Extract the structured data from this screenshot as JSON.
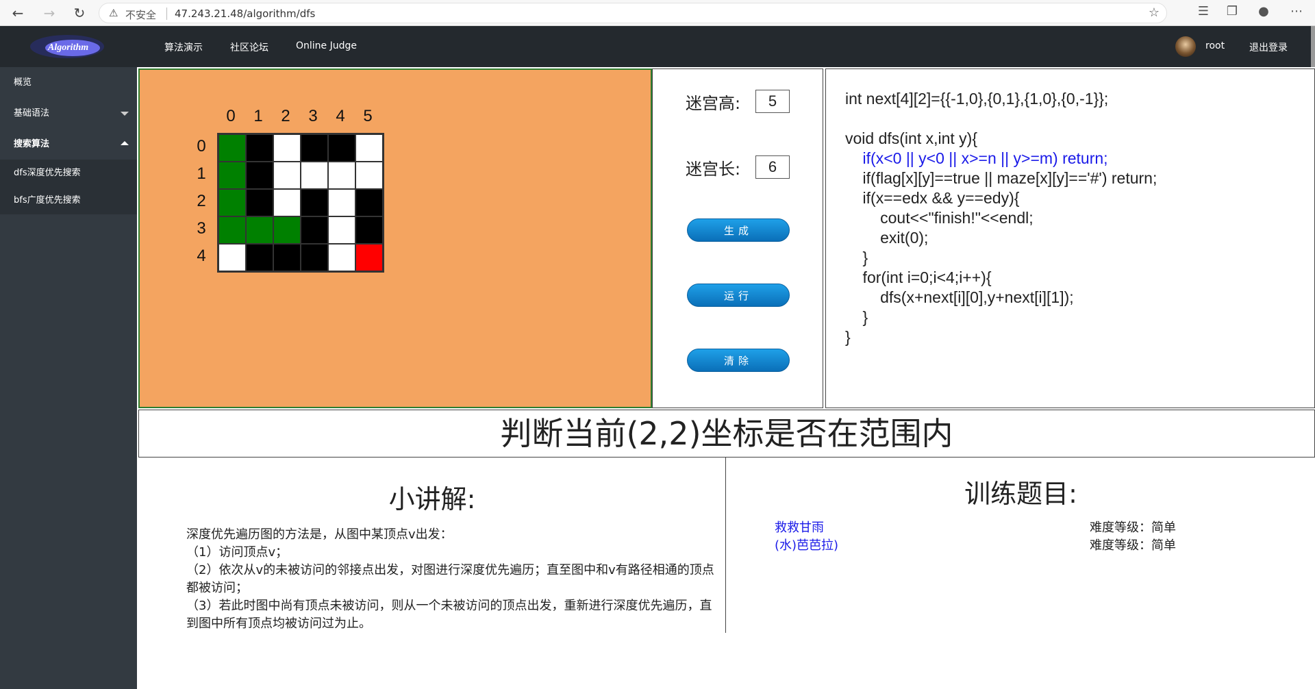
{
  "browser": {
    "insecure_label": "不安全",
    "url": "47.243.21.48/algorithm/dfs"
  },
  "topnav": {
    "logo_text": "Algorithm",
    "links": [
      "算法演示",
      "社区论坛",
      "Online Judge"
    ],
    "username": "root",
    "logout": "退出登录"
  },
  "sidebar": {
    "items": [
      {
        "label": "概览"
      },
      {
        "label": "基础语法"
      },
      {
        "label": "搜索算法"
      }
    ],
    "subitems": [
      {
        "label": "dfs深度优先搜索"
      },
      {
        "label": "bfs广度优先搜索"
      }
    ]
  },
  "maze": {
    "col_labels": [
      "0",
      "1",
      "2",
      "3",
      "4",
      "5"
    ],
    "row_labels": [
      "0",
      "1",
      "2",
      "3",
      "4"
    ],
    "legend_colors": {
      "path": "#008000",
      "wall": "#000000",
      "open": "#ffffff",
      "target": "#ff0000"
    },
    "cells": [
      [
        "path",
        "wall",
        "open",
        "wall",
        "wall",
        "open"
      ],
      [
        "path",
        "wall",
        "open",
        "open",
        "open",
        "open"
      ],
      [
        "path",
        "wall",
        "open",
        "wall",
        "open",
        "wall"
      ],
      [
        "path",
        "path",
        "path",
        "wall",
        "open",
        "wall"
      ],
      [
        "open",
        "wall",
        "wall",
        "wall",
        "open",
        "target"
      ]
    ]
  },
  "controls": {
    "height_label": "迷宫高:",
    "height_value": "5",
    "width_label": "迷宫长:",
    "width_value": "6",
    "generate_label": "生成",
    "run_label": "运行",
    "clear_label": "清除"
  },
  "code": {
    "lines": [
      "int next[4][2]={{-1,0},{0,1},{1,0},{0,-1}};",
      "",
      "void dfs(int x,int y){",
      "    if(x<0 || y<0 || x>=n || y>=m) return;",
      "    if(flag[x][y]==true || maze[x][y]=='#') return;",
      "    if(x==edx && y==edy){",
      "        cout<<\"finish!\"<<endl;",
      "        exit(0);",
      "    }",
      "    for(int i=0;i<4;i++){",
      "        dfs(x+next[i][0],y+next[i][1]);",
      "    }",
      "}"
    ],
    "highlight_line": 3,
    "highlight_color": "#1a1ae8"
  },
  "status_text": "判断当前(2,2)坐标是否在范围内",
  "lecture": {
    "title": "小讲解:",
    "body": "深度优先遍历图的方法是，从图中某顶点v出发：\n（1）访问顶点v；\n（2）依次从v的未被访问的邻接点出发，对图进行深度优先遍历；直至图中和v有路径相通的顶点都被访问；\n（3）若此时图中尚有顶点未被访问，则从一个未被访问的顶点出发，重新进行深度优先遍历，直到图中所有顶点均被访问过为止。"
  },
  "training": {
    "title": "训练题目:",
    "problems": [
      {
        "name": "救救甘雨",
        "difficulty": "难度等级：简单"
      },
      {
        "name": "(水)芭芭拉)",
        "difficulty": "难度等级：简单"
      }
    ]
  }
}
